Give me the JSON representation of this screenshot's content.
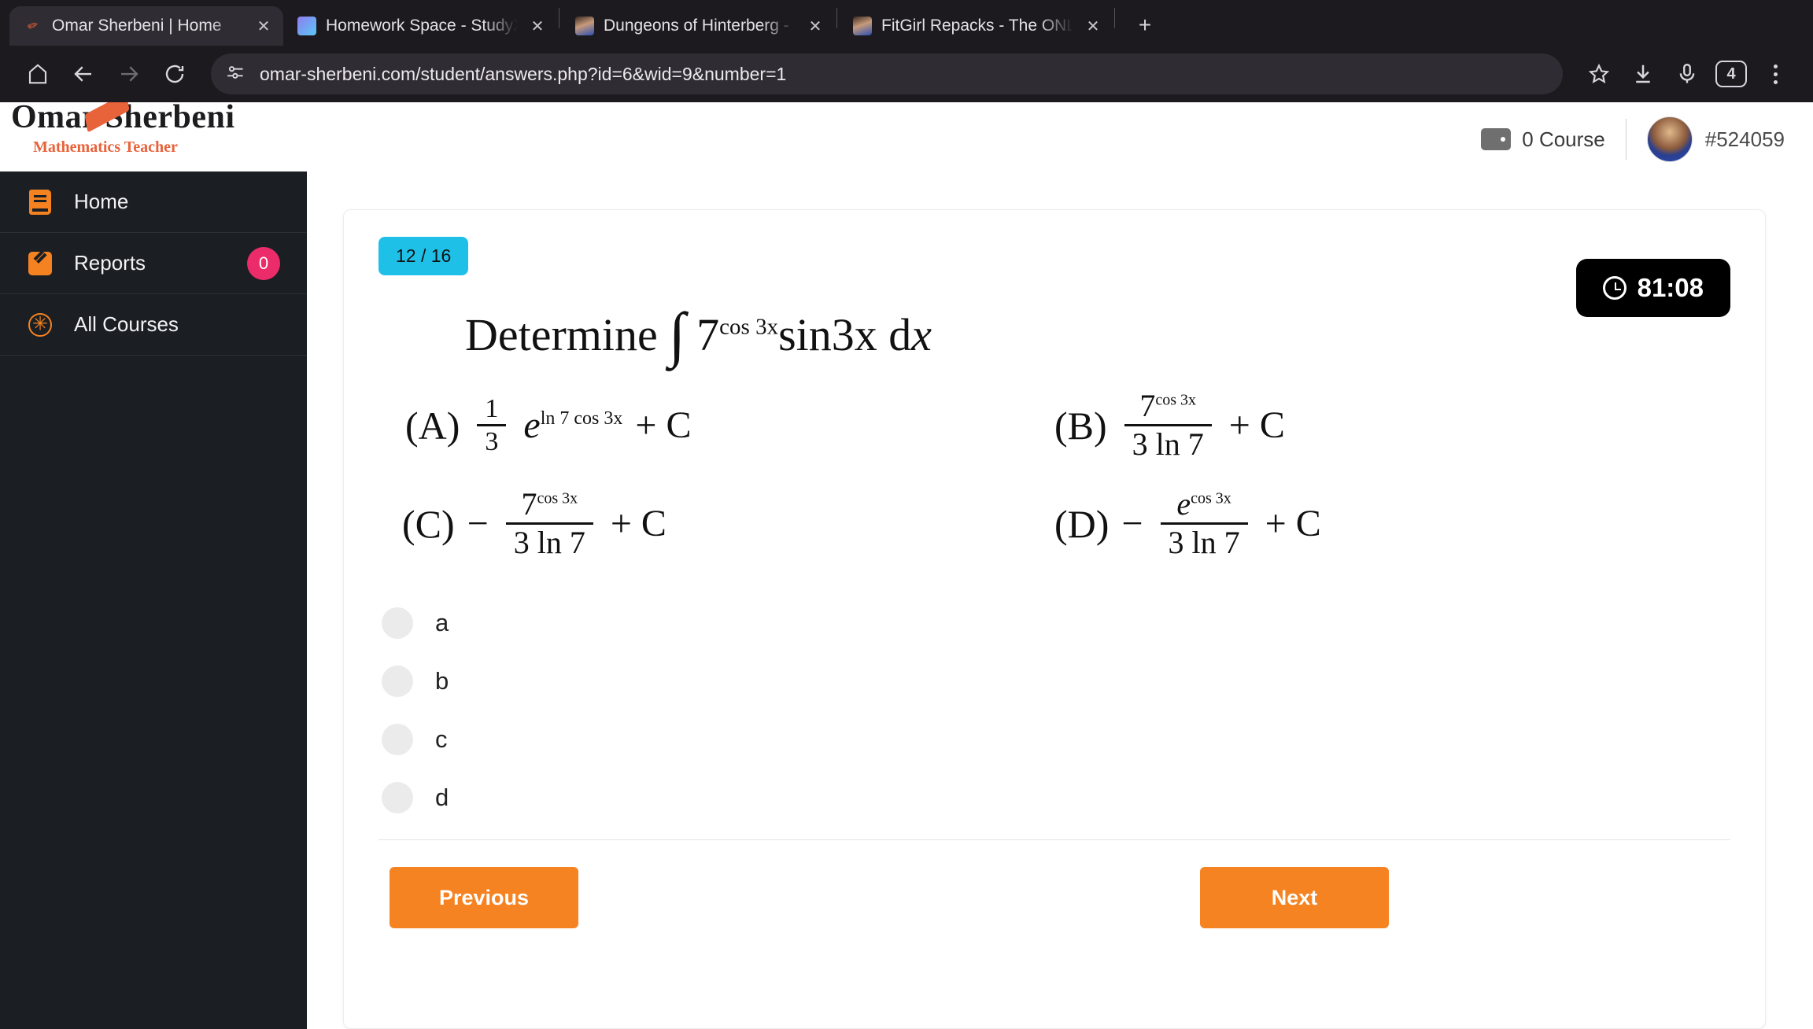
{
  "browser": {
    "tabs": [
      {
        "title": "Omar Sherbeni | Home",
        "favicon": "pencil-icon",
        "active": true
      },
      {
        "title": "Homework Space - StudyX",
        "favicon": "studyx-icon",
        "active": false
      },
      {
        "title": "Dungeons of Hinterberg - v",
        "favicon": "photo-icon",
        "active": false
      },
      {
        "title": "FitGirl Repacks - The ONLY",
        "favicon": "photo-icon",
        "active": false
      }
    ],
    "new_tab_label": "+",
    "close_label": "✕",
    "toolbar": {
      "home_icon": "home-icon",
      "back_icon": "back-arrow-icon",
      "forward_icon": "forward-arrow-icon",
      "reload_icon": "reload-icon",
      "site_info_icon": "site-settings-icon",
      "url": "omar-sherbeni.com/student/answers.php?id=6&wid=9&number=1",
      "bookmark_icon": "star-icon",
      "download_icon": "download-icon",
      "mic_icon": "microphone-icon",
      "profile_count": "4",
      "menu_icon": "kebab-menu-icon"
    }
  },
  "header": {
    "brand_name": "Omar Sherbeni",
    "brand_subtitle": "Mathematics Teacher",
    "course_count": "0 Course",
    "user_id": "#524059",
    "wallet_icon": "wallet-icon",
    "avatar_icon": "user-avatar"
  },
  "sidebar": {
    "items": [
      {
        "label": "Home",
        "icon": "book-icon",
        "badge": ""
      },
      {
        "label": "Reports",
        "icon": "pencil-icon",
        "badge": "0"
      },
      {
        "label": "All Courses",
        "icon": "sunburst-icon",
        "badge": ""
      }
    ]
  },
  "quiz": {
    "progress": "12 / 16",
    "timer": "81:08",
    "timer_icon": "clock-icon",
    "question": {
      "prefix": "Determine",
      "integral": "∫",
      "base": "7",
      "exponent": "cos 3x",
      "tail": "sin3x d",
      "tail_var": "x"
    },
    "options": [
      {
        "label": "(A)",
        "form": "coefficient-exponential",
        "coef_num": "1",
        "coef_den": "3",
        "base": "e",
        "exponent": "ln 7 cos 3x",
        "suffix": "+ C"
      },
      {
        "label": "(B)",
        "form": "fraction",
        "sign": "",
        "num_base": "7",
        "num_exp": "cos 3x",
        "den": "3 ln 7",
        "suffix": "+ C"
      },
      {
        "label": "(C)",
        "form": "fraction",
        "sign": "−",
        "num_base": "7",
        "num_exp": "cos 3x",
        "den": "3 ln 7",
        "suffix": "+ C"
      },
      {
        "label": "(D)",
        "form": "fraction",
        "sign": "−",
        "num_base": "e",
        "num_exp": "cos 3x",
        "den": "3 ln 7",
        "suffix": "+ C"
      }
    ],
    "choices": [
      {
        "value": "a",
        "selected": false
      },
      {
        "value": "b",
        "selected": false
      },
      {
        "value": "c",
        "selected": false
      },
      {
        "value": "d",
        "selected": false
      }
    ],
    "previous_label": "Previous",
    "next_label": "Next"
  }
}
